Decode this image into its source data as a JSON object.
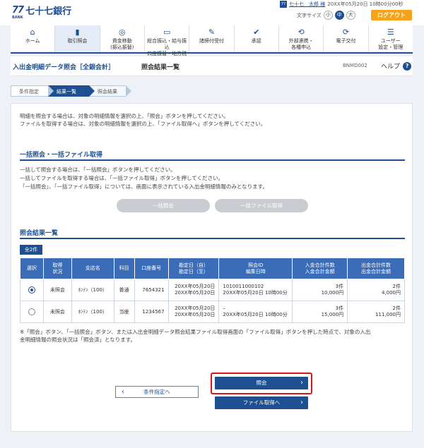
{
  "header": {
    "logo_mark": "77",
    "logo_sub": "BANK",
    "bank_name": "七十七銀行",
    "user_badge": "77",
    "user_name": "七十七　太郎 様",
    "login_time": "20XX年05月20日 10時00分00秒",
    "font_size_label": "文字サイズ",
    "font_sizes": [
      "小",
      "中",
      "大"
    ],
    "font_size_selected": "中",
    "logout_label": "ログアウト"
  },
  "nav": [
    {
      "label": "ホーム",
      "icon": "home-icon",
      "glyph": "⌂"
    },
    {
      "label": "取引照会",
      "icon": "document-icon",
      "glyph": "▮"
    },
    {
      "label": "資金移動\n(振込振替)",
      "icon": "transfer-icon",
      "glyph": "◎"
    },
    {
      "label": "総合振込・給与振込\n口座振替・地方税",
      "icon": "card-icon",
      "glyph": "▭"
    },
    {
      "label": "諸締付受付",
      "icon": "pen-icon",
      "glyph": "✎"
    },
    {
      "label": "承認",
      "icon": "approve-icon",
      "glyph": "✔"
    },
    {
      "label": "外部連携・\n各種申込",
      "icon": "link-icon",
      "glyph": "⟲"
    },
    {
      "label": "電子交付",
      "icon": "refresh-icon",
      "glyph": "⟳"
    },
    {
      "label": "ユーザー\n設定・管理",
      "icon": "user-settings-icon",
      "glyph": "☰"
    }
  ],
  "page": {
    "title": "入出金明細データ照会［全銀会計］",
    "subtitle": "照会結果一覧",
    "screen_id": "BNMD002",
    "help_label": "ヘルプ",
    "help_icon": "?"
  },
  "steps": [
    "条件指定",
    "結果一覧",
    "照会結果"
  ],
  "intro": [
    "明細を照会する場合は、対象の明細情報を選択の上、「照会」ボタンを押してください。",
    "ファイルを取得する場合は、対象の明細情報を選択の上、「ファイル取得へ」ボタンを押してください。"
  ],
  "bulk": {
    "title": "一括照会・一括ファイル取得",
    "lines": [
      "一括して照会する場合は、「一括照会」ボタンを押してください。",
      "一括してファイルを取得する場合は、「一括ファイル取得」ボタンを押してください。",
      "「一括照会」、「一括ファイル取得」については、画面に表示されている入出金明細情報のみとなります。"
    ],
    "bulk_inquiry_label": "一括照会",
    "bulk_file_label": "一括ファイル取得"
  },
  "results": {
    "title": "照会結果一覧",
    "count": "全2件",
    "headers": [
      "選択",
      "取得\n状況",
      "支店名",
      "科目",
      "口座番号",
      "勘定日（自）\n勘定日（至）",
      "照会ID\n編集日時",
      "入金合計件数\n入金合計金額",
      "出金合計件数\n出金合計金額"
    ],
    "rows": [
      {
        "selected": true,
        "status": "未照会",
        "branch": "ﾎﾝﾃﾝ（100）",
        "subject": "普通",
        "account": "7654321",
        "date_from": "20XX年05月20日",
        "date_to": "20XX年05月20日",
        "inquiry_id": "1010011000102",
        "edited": "20XX年05月20日 10時00分",
        "in_count": "3件",
        "in_amount": "10,000円",
        "out_count": "2件",
        "out_amount": "4,000円"
      },
      {
        "selected": false,
        "status": "未照会",
        "branch": "ﾎﾝﾃﾝ（100）",
        "subject": "当座",
        "account": "1234567",
        "date_from": "20XX年05月20日",
        "date_to": "20XX年05月20日",
        "inquiry_id": "–",
        "edited": "20XX年05月20日 10時00分",
        "in_count": "3件",
        "in_amount": "15,000円",
        "out_count": "2件",
        "out_amount": "111,000円"
      }
    ],
    "note": [
      "※「照会」ボタン、「一括照会」ボタン、または入出金明細データ照会結果ファイル取得画面の「ファイル取得」ボタンを押した時点で、対象の入出",
      "金明細情報の照会状況は「照会済」となります。"
    ]
  },
  "actions": {
    "back_label": "条件指定へ",
    "inquiry_label": "照会",
    "file_label": "ファイル取得へ"
  }
}
